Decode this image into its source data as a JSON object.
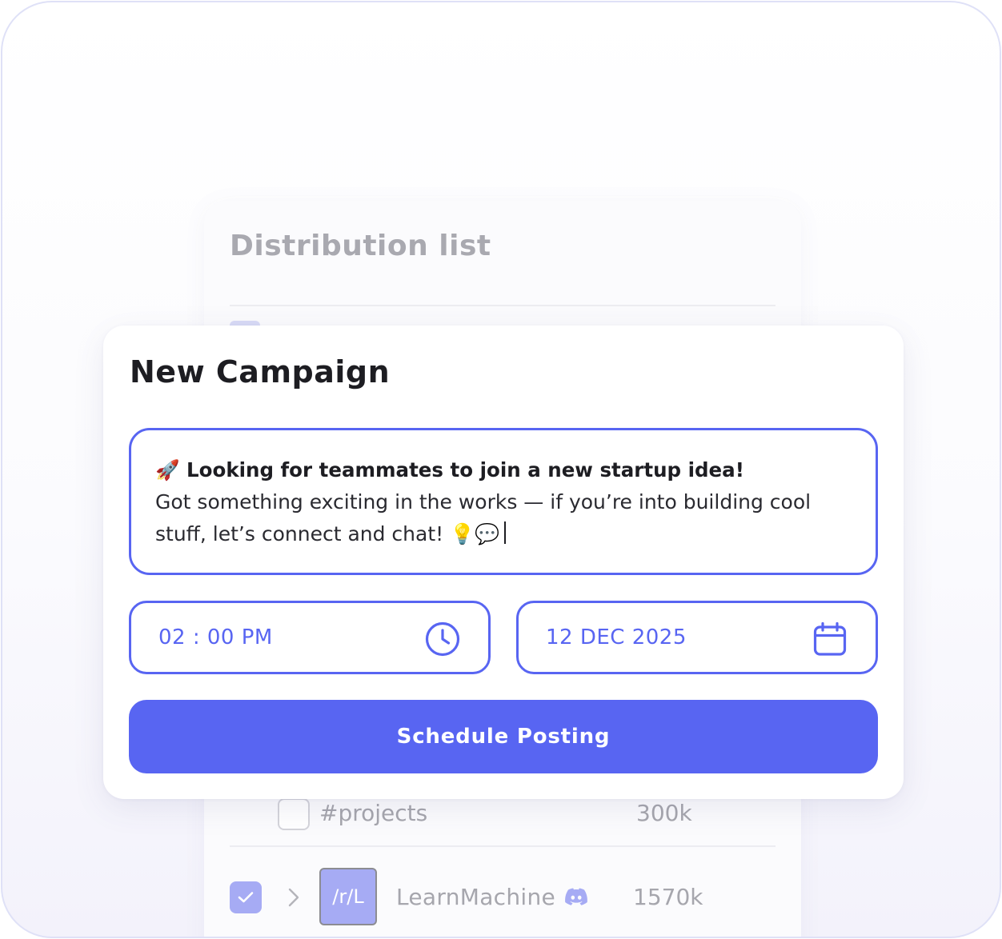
{
  "distribution": {
    "title": "Distribution list",
    "channel_row": {
      "label": "#projects",
      "count": "300k",
      "checked": false
    },
    "community_row": {
      "avatar_text": "/r/L",
      "name": "LearnMachine",
      "platform_icon": "discord-icon",
      "count": "1570k",
      "checked": true
    }
  },
  "campaign": {
    "title": "New Campaign",
    "message": {
      "emoji": "🚀",
      "headline": "Looking for teammates to join a new startup idea!",
      "body": "Got something exciting in the works — if you’re into building cool stuff, let’s connect and chat! 💡💬"
    },
    "time": {
      "value": "02 : 00 PM",
      "icon": "clock-icon"
    },
    "date": {
      "value": "12 DEC 2025",
      "icon": "calendar-icon"
    },
    "schedule_button": "Schedule Posting"
  },
  "colors": {
    "accent": "#5865f2",
    "accent_muted": "#a6abf4",
    "muted_text": "#a6a6ad",
    "title_text": "#1d1d22"
  }
}
